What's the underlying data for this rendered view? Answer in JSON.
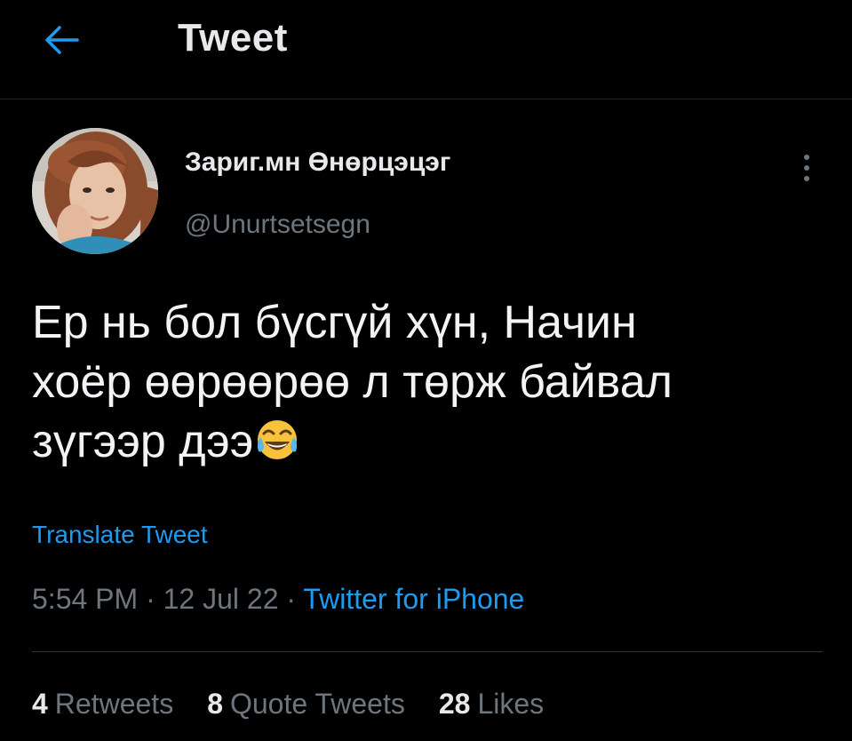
{
  "header": {
    "title": "Tweet",
    "back_icon": "arrow-left-icon"
  },
  "author": {
    "display_name": "Зариг.мн Өнөрцэцэг",
    "handle": "@Unurtsetsegn",
    "avatar_icon": "profile-photo"
  },
  "more_icon": "vertical-ellipsis-icon",
  "tweet": {
    "lines": [
      "Ер нь бол бүсгүй хүн, Начин",
      "хоёр өөрөөрөө л төрж байвал",
      "зүгээр дээ"
    ],
    "emoji": "face-with-tears-of-joy-icon"
  },
  "translate_label": "Translate Tweet",
  "meta": {
    "time": "5:54 PM",
    "separator": " · ",
    "date": "12 Jul 22",
    "source": "Twitter for iPhone"
  },
  "stats": {
    "retweets_count": "4",
    "retweets_label": "Retweets",
    "quotes_count": "8",
    "quotes_label": "Quote Tweets",
    "likes_count": "28",
    "likes_label": "Likes"
  },
  "colors": {
    "background": "#000000",
    "text": "#e7e9ea",
    "secondary": "#6e767d",
    "accent": "#1d9bf0"
  }
}
